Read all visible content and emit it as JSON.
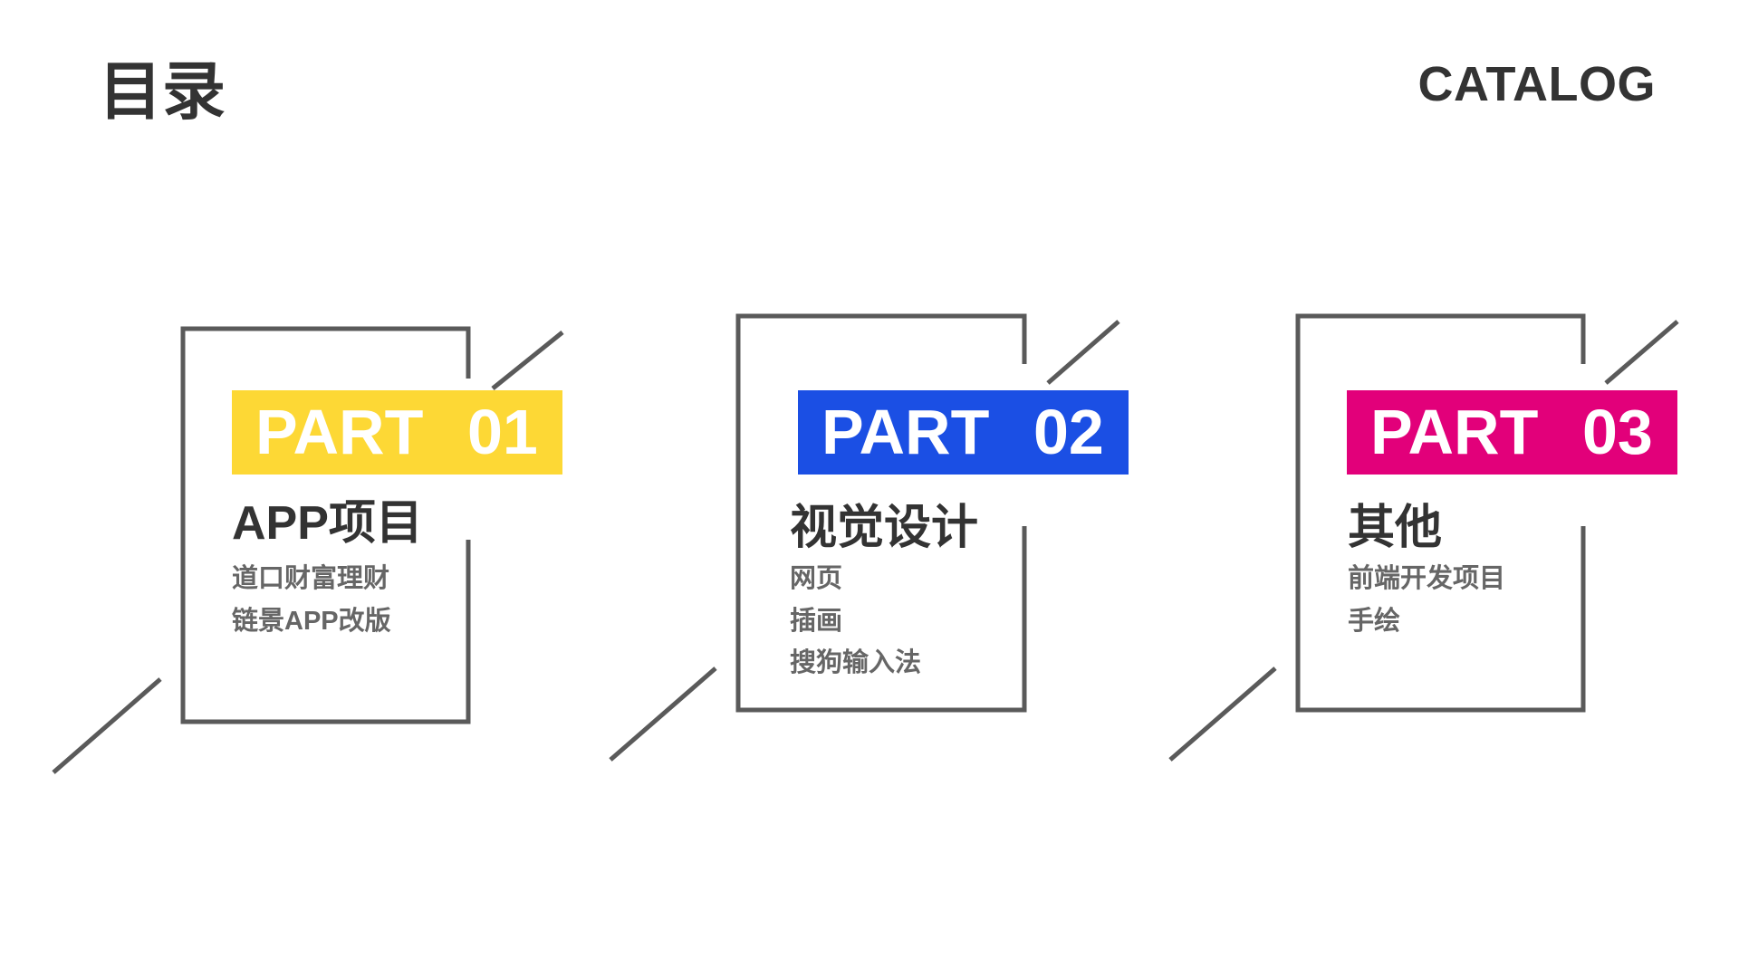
{
  "header": {
    "title": "目录",
    "subtitle": "CATALOG"
  },
  "parts": [
    {
      "label": "PART",
      "number": "01",
      "color": "#FDD835",
      "title": "APP项目",
      "items": [
        "道口财富理财",
        "链景APP改版"
      ]
    },
    {
      "label": "PART",
      "number": "02",
      "color": "#1B4FE4",
      "title": "视觉设计",
      "items": [
        "网页",
        "插画",
        "搜狗输入法"
      ]
    },
    {
      "label": "PART",
      "number": "03",
      "color": "#E2007A",
      "title": "其他",
      "items": [
        "前端开发项目",
        "手绘"
      ]
    }
  ]
}
